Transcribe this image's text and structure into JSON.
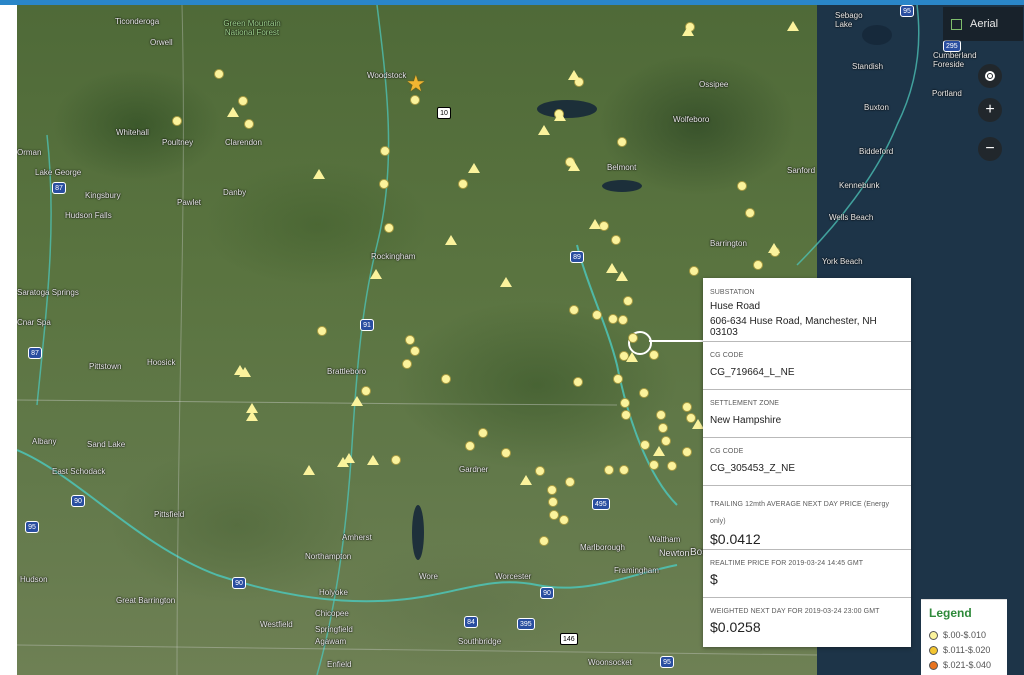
{
  "map_controls": {
    "layer_toggle_label": "Aerial",
    "locate_icon": "target-icon",
    "zoom_in_label": "+",
    "zoom_out_label": "−"
  },
  "place_labels": [
    "Ticonderoga",
    "Green Mountain National Forest",
    "Orwell",
    "Woodstock",
    "Whitehall",
    "Poultney",
    "Clarendon",
    "Lake George",
    "Kingsbury",
    "Hudson Falls",
    "Danby",
    "Pawlet",
    "Rockingham",
    "Saratoga Springs",
    "Brattleboro",
    "Hoosick",
    "Pittstown",
    "Albany",
    "Sand Lake",
    "East Schodack",
    "Pittsfield",
    "Amherst",
    "Northampton",
    "Holyoke",
    "Great Barrington",
    "Westfield",
    "Chicopee",
    "Springfield",
    "Agawam",
    "Enfield",
    "Gardner",
    "Wore",
    "Worcester",
    "Southbridge",
    "Marlborough",
    "Framingham",
    "Waltham",
    "Newton",
    "Boston",
    "Woonsocket",
    "Ossipee",
    "Wolfeboro",
    "Belmont",
    "Sanford",
    "Kennebunk",
    "Wells Beach",
    "Barrington",
    "York Beach",
    "Biddeford",
    "Standish",
    "Buxton",
    "Portland",
    "Cumberland Foreside",
    "Sebago Lake",
    "Hudson",
    "Orman",
    "Cnar Spa"
  ],
  "route_shields": [
    "10",
    "89",
    "91",
    "87",
    "90",
    "495",
    "395",
    "84",
    "146",
    "95",
    "295"
  ],
  "star_marker": "star-icon",
  "info_panel": {
    "substation_label": "SUBSTATION",
    "substation_name": "Huse Road",
    "substation_address": "606-634 Huse Road, Manchester, NH 03103",
    "cg_code_label_1": "CG CODE",
    "cg_code_1": "CG_719664_L_NE",
    "settlement_zone_label": "SETTLEMENT ZONE",
    "settlement_zone": "New Hampshire",
    "cg_code_label_2": "CG CODE",
    "cg_code_2": "CG_305453_Z_NE",
    "trailing_label": "TRAILING 12mth AVERAGE NEXT DAY PRICE (Energy only)",
    "trailing_value": "$0.0412",
    "realtime_label": "REALTIME PRICE FOR 2019-03-24 14:45 GMT",
    "realtime_value": "$",
    "weighted_label": "WEIGHTED NEXT DAY FOR 2019-03-24 23:00 GMT",
    "weighted_value": "$0.0258"
  },
  "legend": {
    "title": "Legend",
    "items": [
      {
        "label": "$.00-$.010",
        "color": "#fbf39c"
      },
      {
        "label": "$.011-$.020",
        "color": "#f3c531"
      },
      {
        "label": "$.021-$.040",
        "color": "#e8731f"
      }
    ]
  },
  "colors": {
    "accent": "#2a86c8",
    "marker": "#fbf39c",
    "legend_title": "#2e8a3a"
  }
}
